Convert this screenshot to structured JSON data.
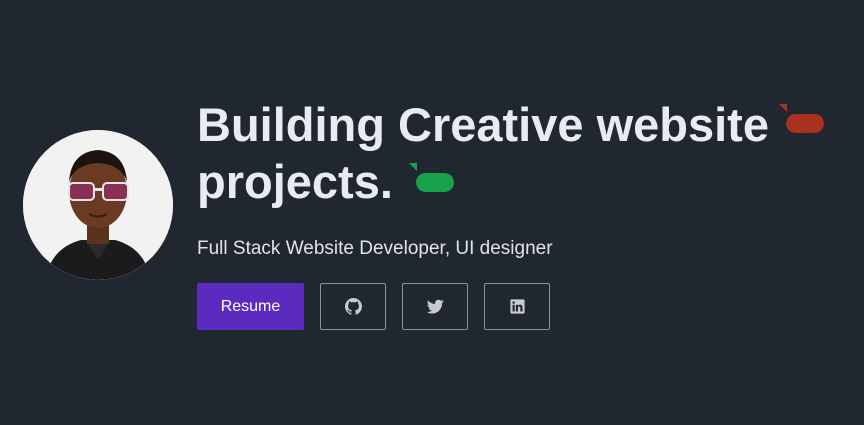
{
  "hero": {
    "headline_line1": "Building Creative website",
    "headline_line2": "projects.",
    "subtitle": "Full Stack Website Developer, UI designer"
  },
  "actions": {
    "resume_label": "Resume",
    "social": [
      {
        "icon": "github-icon"
      },
      {
        "icon": "twitter-icon"
      },
      {
        "icon": "linkedin-icon"
      }
    ]
  },
  "colors": {
    "background": "#212731",
    "accent": "#5b2bc0",
    "cursor_red": "#a8321d",
    "cursor_green": "#16a34a"
  }
}
